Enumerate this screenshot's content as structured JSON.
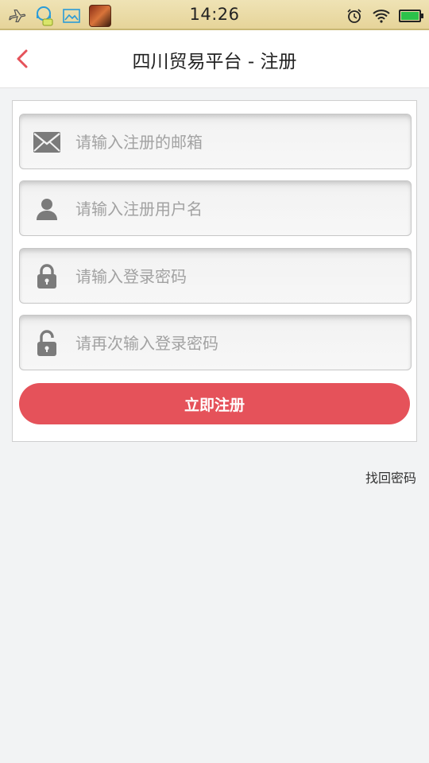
{
  "status_bar": {
    "time": "14:26",
    "icons_left": [
      "airplane-icon",
      "chat-assistant-icon",
      "image-icon",
      "game-avatar-icon"
    ],
    "icons_right": [
      "alarm-icon",
      "wifi-icon",
      "battery-icon"
    ],
    "battery_level": 1.0,
    "battery_color": "#2cc14a"
  },
  "header": {
    "back_icon": "chevron-left-icon",
    "title": "四川贸易平台 - 注册",
    "accent_color": "#e5525a"
  },
  "form": {
    "email": {
      "icon": "envelope-icon",
      "placeholder": "请输入注册的邮箱"
    },
    "username": {
      "icon": "user-icon",
      "placeholder": "请输入注册用户名"
    },
    "password": {
      "icon": "lock-closed-icon",
      "placeholder": "请输入登录密码"
    },
    "password_confirm": {
      "icon": "lock-open-icon",
      "placeholder": "请再次输入登录密码"
    },
    "submit_label": "立即注册"
  },
  "links": {
    "forgot_password": "找回密码"
  }
}
